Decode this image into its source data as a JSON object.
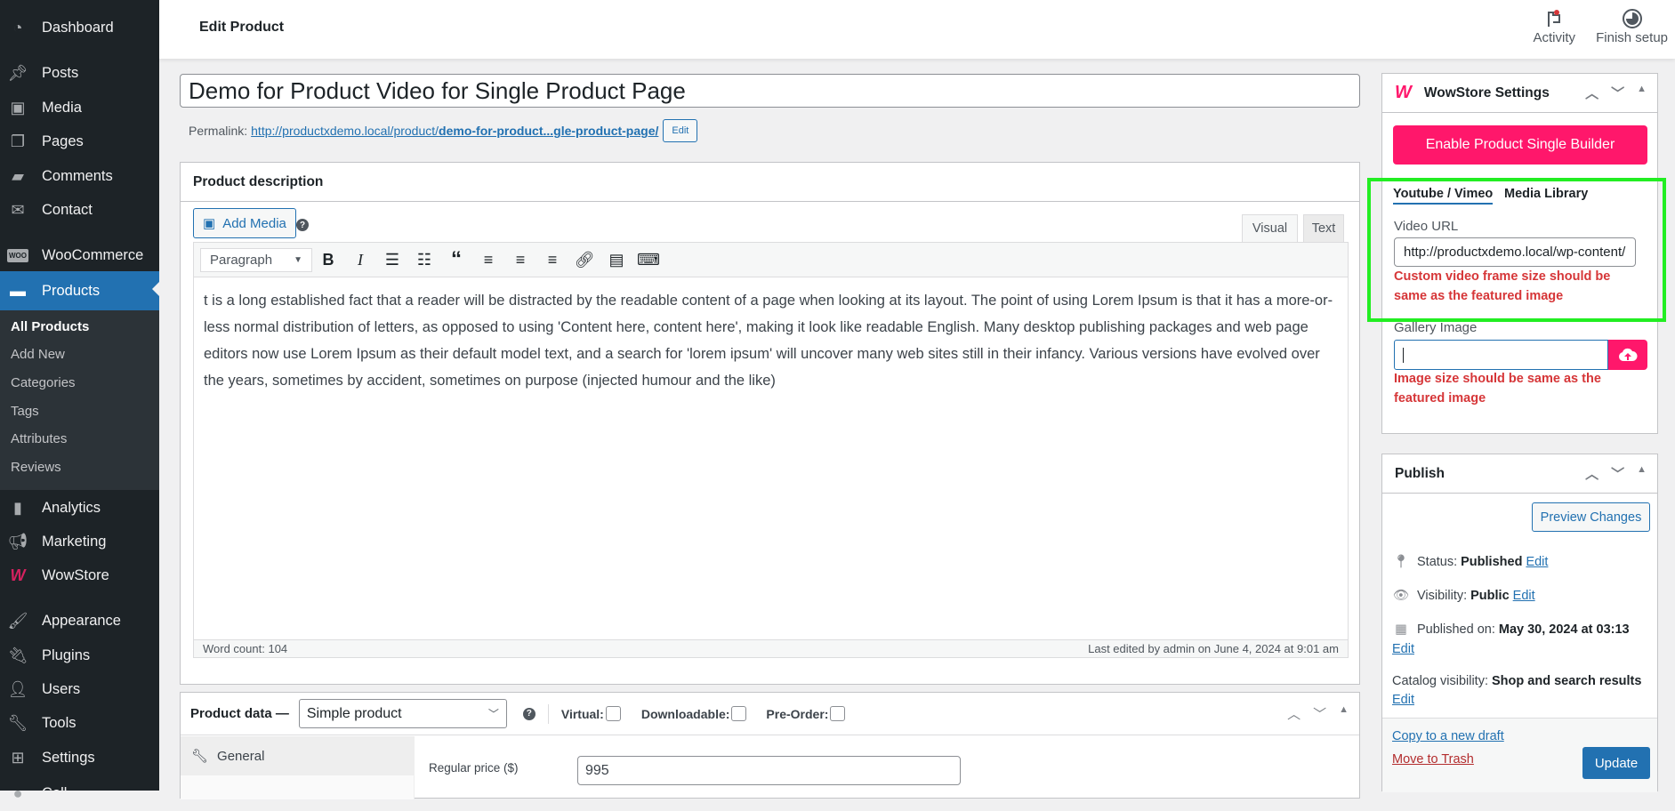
{
  "sidebar": {
    "items": [
      {
        "label": "Dashboard",
        "icon": "dashboard-icon"
      },
      {
        "label": "Posts",
        "icon": "pin-icon"
      },
      {
        "label": "Media",
        "icon": "media-icon"
      },
      {
        "label": "Pages",
        "icon": "pages-icon"
      },
      {
        "label": "Comments",
        "icon": "comment-icon"
      },
      {
        "label": "Contact",
        "icon": "mail-icon"
      },
      {
        "label": "WooCommerce",
        "icon": "woo-icon"
      },
      {
        "label": "Products",
        "icon": "archive-icon"
      },
      {
        "label": "Analytics",
        "icon": "bar-chart-icon"
      },
      {
        "label": "Marketing",
        "icon": "megaphone-icon"
      },
      {
        "label": "WowStore",
        "icon": "wowstore-icon"
      },
      {
        "label": "Appearance",
        "icon": "paintbrush-icon"
      },
      {
        "label": "Plugins",
        "icon": "plug-icon"
      },
      {
        "label": "Users",
        "icon": "user-icon"
      },
      {
        "label": "Tools",
        "icon": "wrench-icon"
      },
      {
        "label": "Settings",
        "icon": "sliders-icon"
      },
      {
        "label": "Coll...",
        "icon": "circle-icon"
      }
    ],
    "submenu": [
      "All Products",
      "Add New",
      "Categories",
      "Tags",
      "Attributes",
      "Reviews"
    ]
  },
  "topbar": {
    "title": "Edit Product",
    "activity_label": "Activity",
    "finish_setup_label": "Finish setup"
  },
  "post": {
    "title": "Demo for Product Video for Single Product Page",
    "permalink_label": "Permalink:",
    "permalink_base": "http://productxdemo.local/product/",
    "permalink_slug": "demo-for-product...gle-product-page/",
    "permalink_edit": "Edit"
  },
  "description": {
    "heading": "Product description",
    "add_media": "Add Media",
    "tab_visual": "Visual",
    "tab_text": "Text",
    "format": "Paragraph",
    "content": "t is a long established fact that a reader will be distracted by the readable content of a page when looking at its layout. The point of using Lorem Ipsum is that it has a more-or-less normal distribution of letters, as opposed to using 'Content here, content here', making it look like readable English. Many desktop publishing packages and web page editors now use Lorem Ipsum as their default model text, and a search for 'lorem ipsum' will uncover many web sites still in their infancy. Various versions have evolved over the years, sometimes by accident, sometimes on purpose (injected humour and the like)",
    "word_count": "Word count: 104",
    "last_edited": "Last edited by admin on June 4, 2024 at 9:01 am"
  },
  "product_data": {
    "label": "Product data —",
    "type": "Simple product",
    "virtual_label": "Virtual:",
    "downloadable_label": "Downloadable:",
    "preorder_label": "Pre-Order:",
    "tab_general": "General",
    "regular_price_label": "Regular price ($)",
    "regular_price": "995"
  },
  "wowstore": {
    "heading": "WowStore Settings",
    "enable_button": "Enable Product Single Builder",
    "tab_youtube": "Youtube / Vimeo",
    "tab_media": "Media Library",
    "video_url_label": "Video URL",
    "video_url": "http://productxdemo.local/wp-content/",
    "video_note": "Custom video frame size should be same as the featured image",
    "gallery_label": "Gallery Image",
    "gallery_value": "",
    "gallery_note": "Image size should be same as the featured image",
    "accent": "#ff176b",
    "highlight": "#22ee22"
  },
  "publish": {
    "heading": "Publish",
    "preview_button": "Preview Changes",
    "status_label": "Status:",
    "status_value": "Published",
    "visibility_label": "Visibility:",
    "visibility_value": "Public",
    "published_label": "Published on:",
    "published_value": "May 30, 2024 at 03:13",
    "catalog_label": "Catalog visibility:",
    "catalog_value": "Shop and search results",
    "edit": "Edit",
    "copy_draft": "Copy to a new draft",
    "trash": "Move to Trash",
    "update_button": "Update"
  }
}
